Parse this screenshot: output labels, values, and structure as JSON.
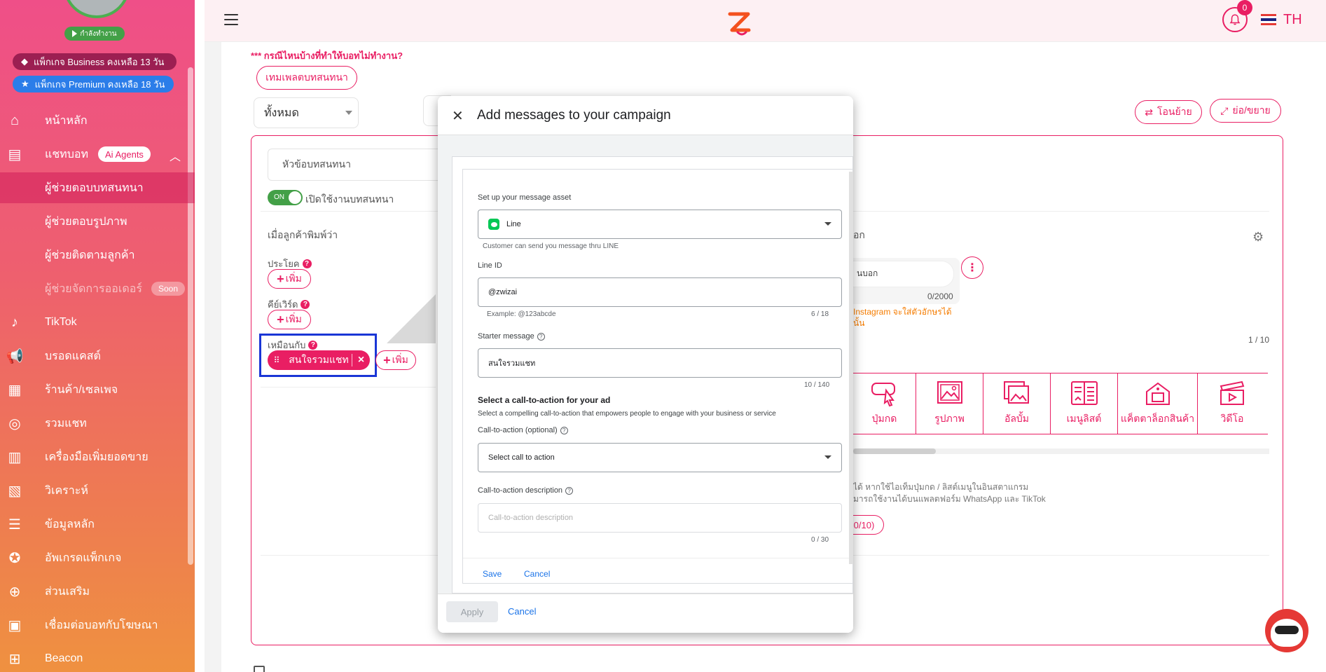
{
  "sidebar": {
    "status": "กำลังทำงาน",
    "package_business": "แพ็กเกจ Business คงเหลือ 13 วัน",
    "package_premium": "แพ็กเกจ Premium คงเหลือ 18 วัน",
    "nav": {
      "home": "หน้าหลัก",
      "chatbot": "แชทบอท",
      "ai_badge": "Ai Agents",
      "conv_assistant": "ผู้ช่วยตอบบทสนทนา",
      "image_assistant": "ผู้ช่วยตอบรูปภาพ",
      "followup_assistant": "ผู้ช่วยติดตามลูกค้า",
      "order_assistant": "ผู้ช่วยจัดการออเดอร์",
      "soon_badge": "Soon",
      "tiktok": "TikTok",
      "broadcast": "บรอดแคสต์",
      "shop": "ร้านค้า/เซลเพจ",
      "all_chat": "รวมแชท",
      "sales_tools": "เครื่องมือเพิ่มยอดขาย",
      "analytics": "วิเคราะห์",
      "master_data": "ข้อมูลหลัก",
      "upgrade": "อัพเกรดแพ็กเกจ",
      "addons": "ส่วนเสริม",
      "ads_connect": "เชื่อมต่อบอทกับโฆษณา",
      "beacon": "Beacon"
    }
  },
  "header": {
    "notification_count": "0",
    "language": "TH"
  },
  "main": {
    "warning": "*** กรณีไหนบ้างที่ทำให้บอทไม่ทำงาน?",
    "template_btn": "เทมเพลตบทสนทนา",
    "filter_value": "ทั้งหมด",
    "transfer_btn": "โอนย้าย",
    "expand_btn": "ย่อ/ขยาย",
    "topic_placeholder": "หัวข้อบทสนทนา",
    "toggle_on": "ON",
    "toggle_label": "เปิดใช้งานบทสนทนา",
    "when_customer_types": "เมื่อลูกค้าพิมพ์ว่า",
    "sentence_label": "ประโยค",
    "keyword_label": "คีย์เวิร์ด",
    "similar_label": "เหมือนกับ",
    "add_label": "เพิ่ม",
    "chip_text": "สนใจรวมแชท",
    "right_partial_heading": "อก",
    "msg_partial": "นบอก",
    "msg_counter": "0/2000",
    "ig_warning_1": "Instagram จะใส่ตัวอักษรได้",
    "ig_warning_2": "นั้น",
    "page_counter": "1 / 10",
    "types": [
      "ปุ่มกด",
      "รูปภาพ",
      "อัลบั้ม",
      "เมนูลิสต์",
      "แค็ตตาล็อกสินค้า",
      "วิดีโอ"
    ],
    "note_1": "ได้ หากใช้ไอเท็มปุ่มกด / ลิสต์เมนูในอินสตาแกรม",
    "note_2": "มารถใช้งานได้บนแพลตฟอร์ม WhatsApp และ TikTok",
    "quick_counter": "0/10)"
  },
  "modal": {
    "title": "Add messages to your campaign",
    "setup_label": "Set up your message asset",
    "asset_value": "Line",
    "asset_hint": "Customer can send you message thru LINE",
    "line_id_label": "Line ID",
    "line_id_value": "@zwizai",
    "line_id_example": "Example: @123abcde",
    "line_id_count": "6 / 18",
    "starter_label": "Starter message",
    "starter_value": "สนใจรวมแชท",
    "starter_count": "10 / 140",
    "cta_title": "Select a call-to-action for your ad",
    "cta_desc": "Select a compelling call-to-action that empowers people to engage with your business or service",
    "cta_label": "Call-to-action (optional)",
    "cta_value": "Select call to action",
    "cta_desc_label": "Call-to-action description",
    "cta_desc_placeholder": "Call-to-action description",
    "cta_desc_count": "0 / 30",
    "save": "Save",
    "cancel": "Cancel",
    "apply": "Apply",
    "cancel_footer": "Cancel"
  },
  "colors": {
    "brand": "#e91e63",
    "sidebar_top": "#ef4f88",
    "sidebar_bottom": "#ef9140",
    "highlight": "#1a36d6",
    "link": "#1a73e8"
  }
}
